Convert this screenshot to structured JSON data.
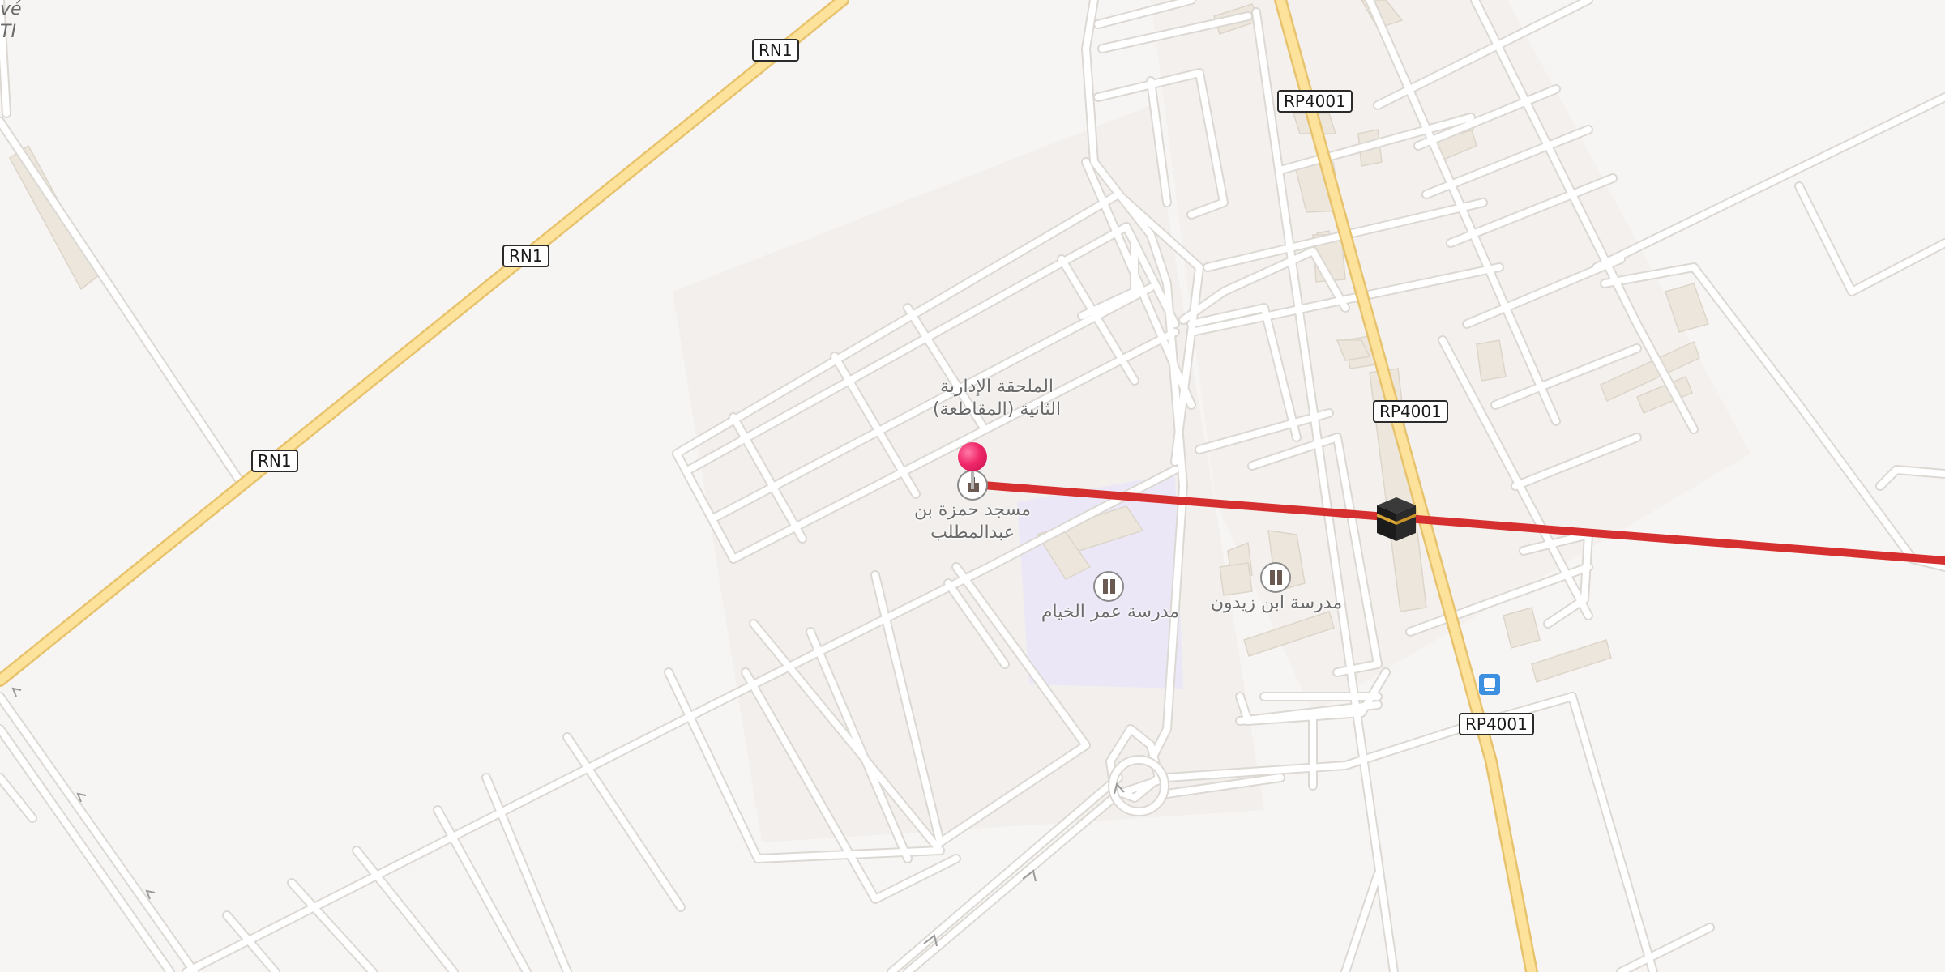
{
  "colors": {
    "background": "#f7f5f3",
    "minor_road": "#ffffff",
    "minor_road_casing": "#dedbd7",
    "major_road": "#fde29b",
    "major_road_casing": "#e8c36e",
    "route_line": "#d62f2f",
    "building": "#ece6dd",
    "school_area": "#ece7f7",
    "marker": "#f0286a",
    "bus_stop": "#3d8fe0"
  },
  "road_labels": {
    "rn1_a": "RN1",
    "rn1_b": "RN1",
    "rn1_c": "RN1",
    "rp4001_a": "RP4001",
    "rp4001_b": "RP4001",
    "rp4001_c": "RP4001"
  },
  "places": {
    "admin_annex_line1": "الملحقة الإدارية",
    "admin_annex_line2": "الثانية (المقاطعة)",
    "mosque_line1": "مسجد حمزة بن",
    "mosque_line2": "عبدالمطلب",
    "school_omar": "مدرسة عمر الخيام",
    "school_ibn": "مدرسة ابن زيدون"
  },
  "edge_text": {
    "line1": "vé",
    "line2": "TI"
  },
  "icons": {
    "marker": "location-pin-icon",
    "mosque": "mosque-icon",
    "school_1": "school-icon",
    "school_2": "school-icon",
    "kaaba": "kaaba-icon",
    "bus": "bus-stop-icon"
  }
}
